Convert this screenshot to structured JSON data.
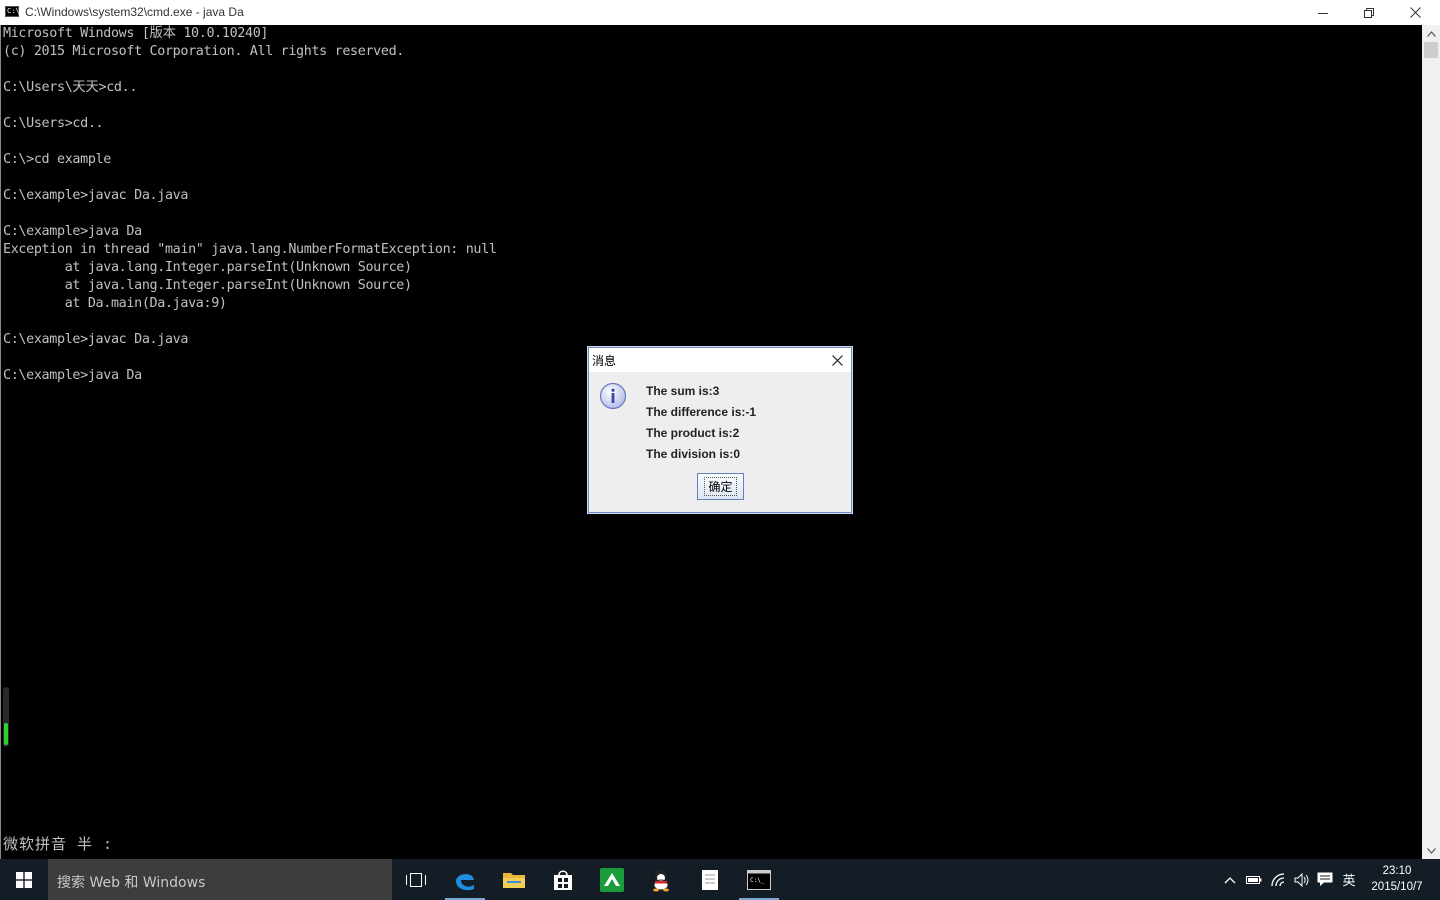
{
  "window": {
    "title": "C:\\Windows\\system32\\cmd.exe - java  Da",
    "app_icon_text": "C:\\"
  },
  "console": {
    "lines": [
      "Microsoft Windows [版本 10.0.10240]",
      "(c) 2015 Microsoft Corporation. All rights reserved.",
      "",
      "C:\\Users\\天天>cd..",
      "",
      "C:\\Users>cd..",
      "",
      "C:\\>cd example",
      "",
      "C:\\example>javac Da.java",
      "",
      "C:\\example>java Da",
      "Exception in thread \"main\" java.lang.NumberFormatException: null",
      "        at java.lang.Integer.parseInt(Unknown Source)",
      "        at java.lang.Integer.parseInt(Unknown Source)",
      "        at Da.main(Da.java:9)",
      "",
      "C:\\example>javac Da.java",
      "",
      "C:\\example>java Da"
    ],
    "ime_status": "微软拼音 半 :"
  },
  "dialog": {
    "title": "消息",
    "icon": "info-icon",
    "messages": [
      "The sum is:3",
      "The difference is:-1",
      "The product is:2",
      "The division is:0"
    ],
    "ok_label": "确定"
  },
  "taskbar": {
    "search_placeholder": "搜索 Web 和 Windows",
    "pinned": [
      "task-view-icon",
      "edge-icon",
      "file-explorer-icon",
      "store-icon",
      "green-app-icon",
      "qq-icon",
      "notepad-icon",
      "cmd-icon"
    ],
    "ime_indicator": "英",
    "time": "23:10",
    "date": "2015/10/7"
  },
  "colors": {
    "console_bg": "#000000",
    "console_text": "#c0c0c0",
    "taskbar_bg": "#141c26",
    "dialog_border": "#6f8fbf"
  }
}
